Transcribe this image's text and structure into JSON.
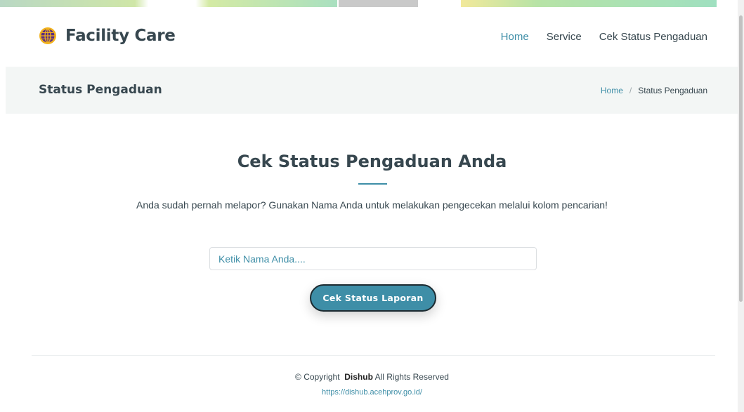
{
  "header": {
    "brand": "Facility Care",
    "nav": [
      {
        "label": "Home",
        "active": true
      },
      {
        "label": "Service",
        "active": false
      },
      {
        "label": "Cek Status Pengaduan",
        "active": false
      }
    ]
  },
  "page_title": {
    "title": "Status Pengaduan",
    "breadcrumb": {
      "home": "Home",
      "separator": "/",
      "current": "Status Pengaduan"
    }
  },
  "main": {
    "heading": "Cek Status Pengaduan Anda",
    "description": "Anda sudah pernah melapor? Gunakan Nama Anda untuk melakukan pengecekan melalui kolom pencarian!",
    "search": {
      "value": "",
      "placeholder": "Ketik Nama Anda...."
    },
    "button_label": "Cek Status Laporan"
  },
  "footer": {
    "copyright_prefix": "© Copyright",
    "org": "Dishub",
    "rights": "All Rights Reserved",
    "link": "https://dishub.acehprov.go.id/"
  },
  "colors": {
    "accent": "#3e8ea7",
    "text_dark": "#37474f",
    "logo_purple": "#5a2d82",
    "logo_yellow": "#f2b21c"
  },
  "icons": {
    "logo": "globe-emblem-icon"
  }
}
